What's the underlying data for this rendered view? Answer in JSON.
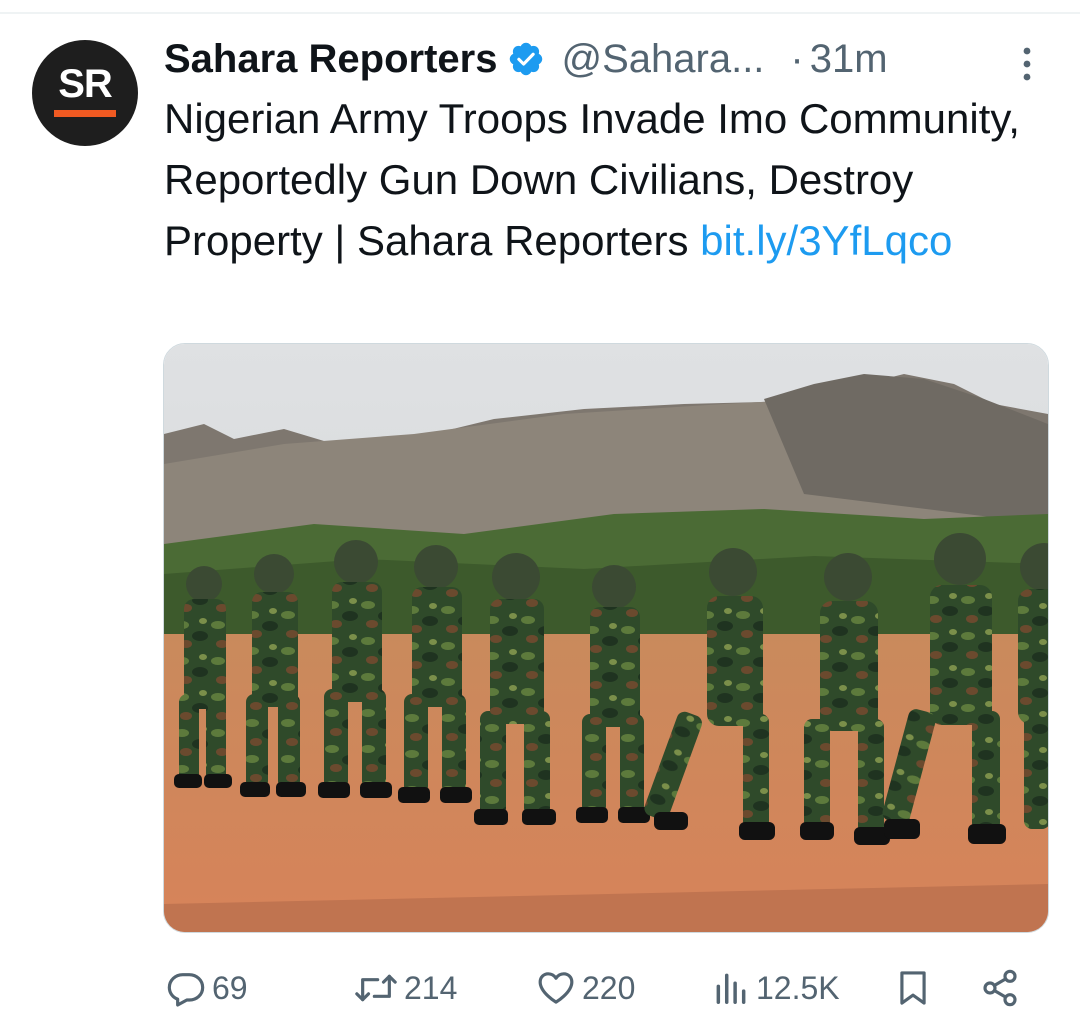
{
  "tweet": {
    "author": {
      "avatar_text": "SR",
      "display_name": "Sahara Reporters",
      "verified": true,
      "handle": "@Sahara...",
      "separator": "·",
      "time": "31m"
    },
    "text": "Nigerian Army Troops Invade Imo Community, Reportedly Gun Down Civilians, Destroy Property | Sahara Reporters",
    "link_text": "bit.ly/3YfLqco",
    "icons": {
      "verified": "verified-badge-icon",
      "more": "more-options-icon",
      "reply": "reply-icon",
      "retweet": "retweet-icon",
      "like": "like-icon",
      "views": "views-icon",
      "bookmark": "bookmark-icon",
      "share": "share-icon"
    },
    "stats": {
      "replies": "69",
      "retweets": "214",
      "likes": "220",
      "views": "12.5K"
    }
  },
  "colors": {
    "accent": "#1d9bf0",
    "secondary_text": "#536471",
    "avatar_bg": "#1e1e1e",
    "avatar_bar": "#f05a22"
  }
}
